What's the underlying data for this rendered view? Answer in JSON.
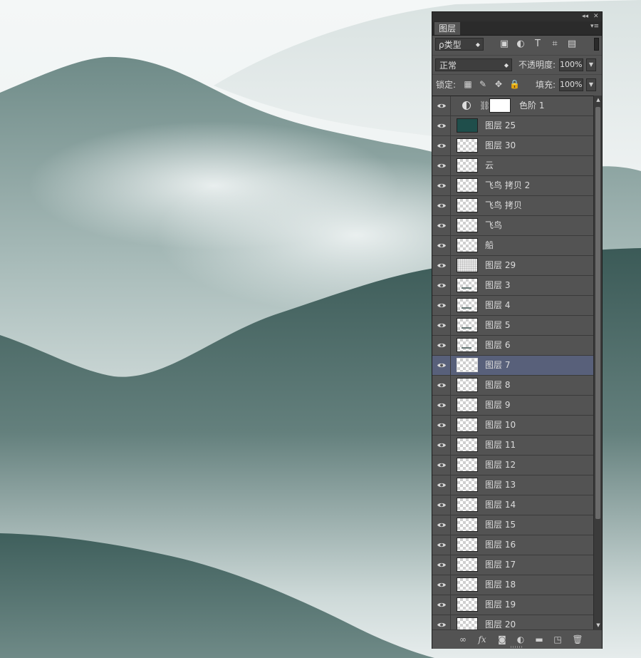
{
  "panel": {
    "tab": "图层",
    "kind_filter": "ρ类型",
    "blend_mode": "正常",
    "opacity_label": "不透明度:",
    "opacity_value": "100%",
    "lock_label": "锁定:",
    "fill_label": "填充:",
    "fill_value": "100%"
  },
  "icons": {
    "collapse": "collapse-icon",
    "close": "close-icon",
    "panel_menu": "panel-menu-icon",
    "filter": [
      "image-filter-icon",
      "adjustment-filter-icon",
      "type-filter-icon",
      "shape-filter-icon",
      "smart-object-filter-icon"
    ],
    "lock": [
      "lock-transparent-icon",
      "lock-paint-icon",
      "lock-position-icon",
      "lock-all-icon"
    ],
    "bottom": [
      "link-icon",
      "fx-icon",
      "add-mask-icon",
      "new-adjustment-icon",
      "new-group-icon",
      "new-layer-icon",
      "delete-icon"
    ]
  },
  "layers": [
    {
      "name": "色阶 1",
      "type": "adjustment"
    },
    {
      "name": "图层 25",
      "type": "solid",
      "thumb_color": "#1f4e4b"
    },
    {
      "name": "图层 30",
      "type": "transparent"
    },
    {
      "name": "云",
      "type": "transparent"
    },
    {
      "name": "飞鸟 拷贝 2",
      "type": "transparent"
    },
    {
      "name": "飞鸟 拷贝",
      "type": "transparent"
    },
    {
      "name": "飞鸟",
      "type": "transparent"
    },
    {
      "name": "船",
      "type": "transparent"
    },
    {
      "name": "图层 29",
      "type": "noise"
    },
    {
      "name": "图层 3",
      "type": "stroke"
    },
    {
      "name": "图层 4",
      "type": "stroke"
    },
    {
      "name": "图层 5",
      "type": "stroke"
    },
    {
      "name": "图层 6",
      "type": "stroke"
    },
    {
      "name": "图层 7",
      "type": "transparent",
      "selected": true
    },
    {
      "name": "图层 8",
      "type": "transparent"
    },
    {
      "name": "图层 9",
      "type": "transparent"
    },
    {
      "name": "图层 10",
      "type": "transparent"
    },
    {
      "name": "图层 11",
      "type": "transparent"
    },
    {
      "name": "图层 12",
      "type": "transparent"
    },
    {
      "name": "图层 13",
      "type": "transparent"
    },
    {
      "name": "图层 14",
      "type": "transparent"
    },
    {
      "name": "图层 15",
      "type": "transparent"
    },
    {
      "name": "图层 16",
      "type": "transparent"
    },
    {
      "name": "图层 17",
      "type": "transparent"
    },
    {
      "name": "图层 18",
      "type": "transparent"
    },
    {
      "name": "图层 19",
      "type": "transparent"
    },
    {
      "name": "图层 20",
      "type": "transparent"
    }
  ],
  "colors": {
    "panel_bg": "#535353",
    "selected_row": "#58607a",
    "mountain_dark": "#3b5a57",
    "mountain_light": "#7e9895",
    "mist": "#e9eeee"
  }
}
